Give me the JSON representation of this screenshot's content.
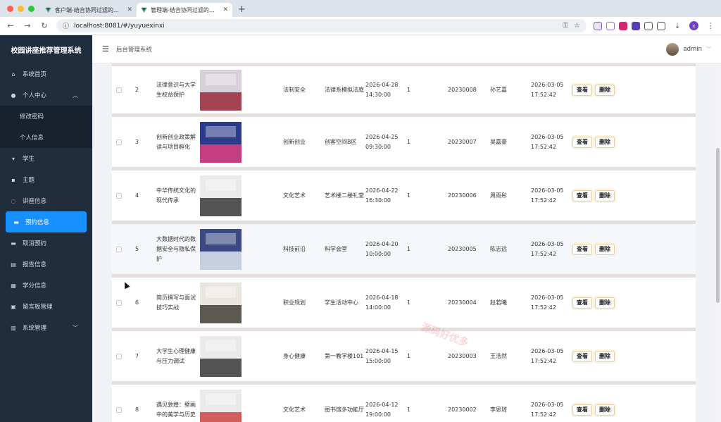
{
  "browser": {
    "tabs": [
      {
        "title": "客户端-结合协同过滤的校园讲座推荐系统"
      },
      {
        "title": "管理端-结合协同过滤的校园讲座推荐系统"
      }
    ],
    "url": "localhost:8081/#/yuyuexinxi",
    "profile_initial": "x"
  },
  "sidebar": {
    "brand": "校园讲座推荐管理系统",
    "items": [
      {
        "label": "系统首页",
        "icon": "home-icon"
      },
      {
        "label": "个人中心",
        "icon": "user-icon"
      },
      {
        "label": "修改密码"
      },
      {
        "label": "个人信息"
      },
      {
        "label": "学生",
        "icon": "user-tag-icon"
      },
      {
        "label": "主题",
        "icon": "theme-icon"
      },
      {
        "label": "讲座信息",
        "icon": "lecture-icon"
      },
      {
        "label": "预约信息",
        "icon": "reservation-icon"
      },
      {
        "label": "取消预约",
        "icon": "cancel-icon"
      },
      {
        "label": "报告信息",
        "icon": "report-icon"
      },
      {
        "label": "学分信息",
        "icon": "credit-icon"
      },
      {
        "label": "留言板管理",
        "icon": "message-icon"
      },
      {
        "label": "系统管理",
        "icon": "system-icon"
      }
    ]
  },
  "header": {
    "breadcrumb": "后台管理系统",
    "username": "admin"
  },
  "actions": {
    "view": "查看",
    "delete": "删除"
  },
  "rows": [
    {
      "index": "2",
      "title": "法律意识与大学生权益保护",
      "theme": "法制安全",
      "location": "法律系模拟法庭",
      "time": "2026-04-28 14:30:00",
      "count": "1",
      "student_no": "20230008",
      "student_name": "孙艺嘉",
      "reserve_time": "2026-03-05 17:52:42"
    },
    {
      "index": "3",
      "title": "创新创业政策解读与项目孵化",
      "theme": "创新创业",
      "location": "创客空间B区",
      "time": "2026-04-25 09:30:00",
      "count": "1",
      "student_no": "20230007",
      "student_name": "吴嘉豪",
      "reserve_time": "2026-03-05 17:52:42"
    },
    {
      "index": "4",
      "title": "中华传统文化的现代传承",
      "theme": "文化艺术",
      "location": "艺术楼二楼礼堂",
      "time": "2026-04-22 16:30:00",
      "count": "1",
      "student_no": "20230006",
      "student_name": "周雨彤",
      "reserve_time": "2026-03-05 17:52:42"
    },
    {
      "index": "5",
      "title": "大数据时代的数据安全与隐私保护",
      "theme": "科技前沿",
      "location": "科学会堂",
      "time": "2026-04-20 10:00:00",
      "count": "1",
      "student_no": "20230005",
      "student_name": "陈志远",
      "reserve_time": "2026-03-05 17:52:42"
    },
    {
      "index": "6",
      "title": "简历撰写与面试技巧实战",
      "theme": "职业规划",
      "location": "学生活动中心",
      "time": "2026-04-18 14:00:00",
      "count": "1",
      "student_no": "20230004",
      "student_name": "赵若曦",
      "reserve_time": "2026-03-05 17:52:42"
    },
    {
      "index": "7",
      "title": "大学生心理健康与压力调试",
      "theme": "身心健康",
      "location": "第一教学楼101",
      "time": "2026-04-15 15:00:00",
      "count": "1",
      "student_no": "20230003",
      "student_name": "王浩然",
      "reserve_time": "2026-03-05 17:52:42"
    },
    {
      "index": "8",
      "title": "遇见敦煌：壁画中的美学与历史",
      "theme": "文化艺术",
      "location": "图书馆多功能厅",
      "time": "2026-04-12 19:00:00",
      "count": "1",
      "student_no": "20230002",
      "student_name": "李思琦",
      "reserve_time": "2026-03-05 17:52:42"
    }
  ],
  "watermark": "源码好优多",
  "colors": {
    "sidebar_bg": "#1f2d3d",
    "active": "#1890ff",
    "row_divider": "#e6dddd"
  }
}
